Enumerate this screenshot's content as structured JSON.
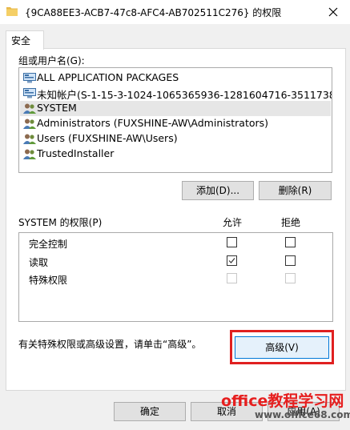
{
  "window": {
    "title": "{9CA88EE3-ACB7-47c8-AFC4-AB702511C276} 的权限",
    "close_glyph": "✕"
  },
  "tabs": [
    {
      "label": "安全"
    }
  ],
  "groups": {
    "label": "组或用户名(G):",
    "items": [
      {
        "name": "ALL APPLICATION PACKAGES",
        "icon": "network-group-icon",
        "selected": false
      },
      {
        "name": "未知帐户(S-1-15-3-1024-1065365936-1281604716-3511738...",
        "icon": "network-group-icon",
        "selected": false
      },
      {
        "name": "SYSTEM",
        "icon": "users-group-icon",
        "selected": true
      },
      {
        "name": "Administrators (FUXSHINE-AW\\Administrators)",
        "icon": "users-group-icon",
        "selected": false
      },
      {
        "name": "Users (FUXSHINE-AW\\Users)",
        "icon": "users-group-icon",
        "selected": false
      },
      {
        "name": "TrustedInstaller",
        "icon": "users-group-icon",
        "selected": false
      }
    ],
    "add_label": "添加(D)...",
    "remove_label": "删除(R)"
  },
  "permissions": {
    "header": "SYSTEM 的权限(P)",
    "allow_header": "允许",
    "deny_header": "拒绝",
    "rows": [
      {
        "name": "完全控制",
        "allow": false,
        "deny": false,
        "enabled": true
      },
      {
        "name": "读取",
        "allow": true,
        "deny": false,
        "enabled": true
      },
      {
        "name": "特殊权限",
        "allow": false,
        "deny": false,
        "enabled": false
      }
    ]
  },
  "advanced": {
    "hint": "有关特殊权限或高级设置，请单击“高级”。",
    "button_label": "高级(V)"
  },
  "footer": {
    "ok_label": "确定",
    "cancel_label": "取消",
    "apply_label": "应用(A)"
  },
  "watermark": {
    "text": "office教程学习网",
    "url": "www.office68.com"
  },
  "colors": {
    "highlight_frame": "#e02020",
    "watermark": "#e61e1e",
    "accent": "#0078d7"
  }
}
